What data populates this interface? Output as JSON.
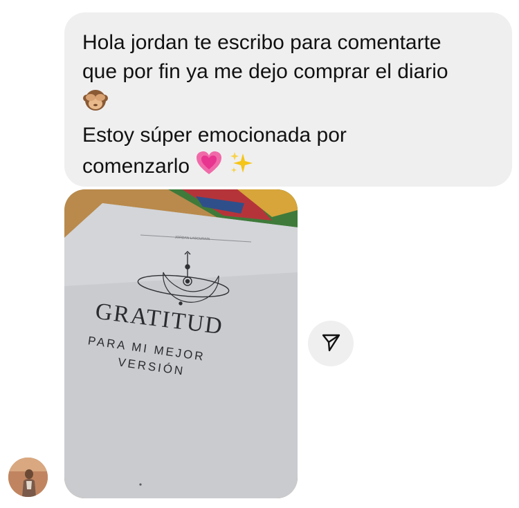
{
  "message": {
    "lines": [
      "Hola jordan te escribo para comentarte",
      "que por fin ya me dejo comprar el diario",
      "",
      "Estoy súper emocionada por",
      "comenzarlo"
    ],
    "emojis": [
      "see-no-evil-monkey-icon",
      "growing-heart-icon",
      "sparkles-icon"
    ]
  },
  "photo": {
    "header": "JORDAN LASCURAIN",
    "title": "GRATITUD",
    "subtitle_line1": "PARA MI MEJOR",
    "subtitle_line2": "VERSIÓN"
  },
  "actions": {
    "share_icon": "paper-plane-icon"
  },
  "colors": {
    "bubble_bg": "#efefef",
    "text": "#111111",
    "heart": "#e8358f",
    "sparkle": "#f5c518"
  }
}
